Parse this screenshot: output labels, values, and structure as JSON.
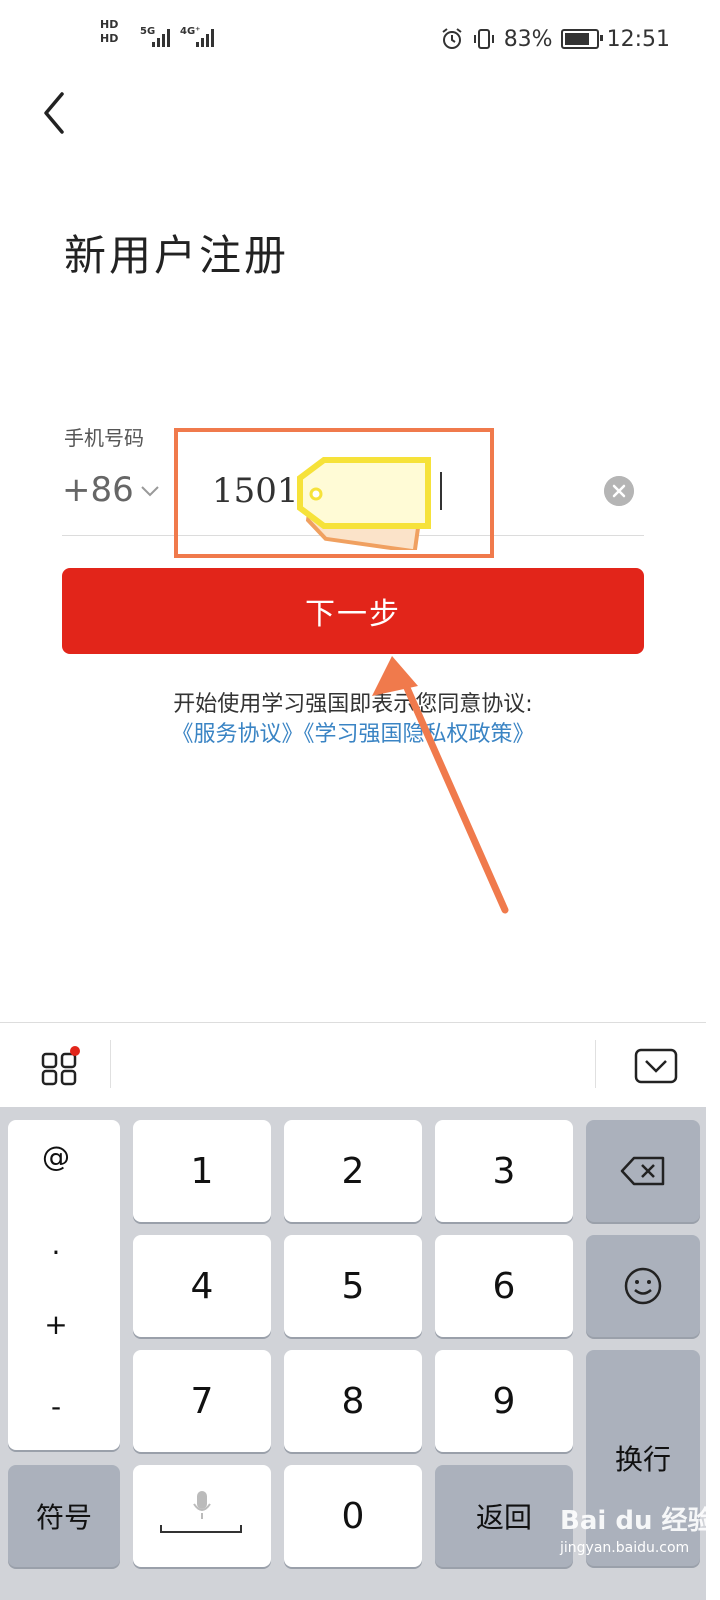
{
  "status_bar": {
    "hd1": "HD",
    "hd2": "HD",
    "network1": "5G",
    "network2": "4G⁺",
    "battery_percent": "83%",
    "time": "12:51"
  },
  "page": {
    "title": "新用户注册",
    "phone_label": "手机号码",
    "country_code": "+86",
    "phone_value": "1501",
    "next_button": "下一步",
    "agreement_text": "开始使用学习强国即表示您同意协议:",
    "service_link": "《服务协议》",
    "privacy_link": "《学习强国隐私权政策》"
  },
  "keyboard": {
    "symbols": [
      "@",
      ".",
      "+",
      "-"
    ],
    "digits": [
      "1",
      "2",
      "3",
      "4",
      "5",
      "6",
      "7",
      "8",
      "9",
      "0"
    ],
    "symbols_key": "符号",
    "return_key": "返回",
    "newline_key": "换行"
  },
  "watermark": {
    "brand": "Bai du 经验",
    "url": "jingyan.baidu.com"
  },
  "colors": {
    "primary": "#e2251a",
    "link": "#3a84c4",
    "highlight": "#f07a4c",
    "keyboard_bg": "#d1d3d8"
  }
}
